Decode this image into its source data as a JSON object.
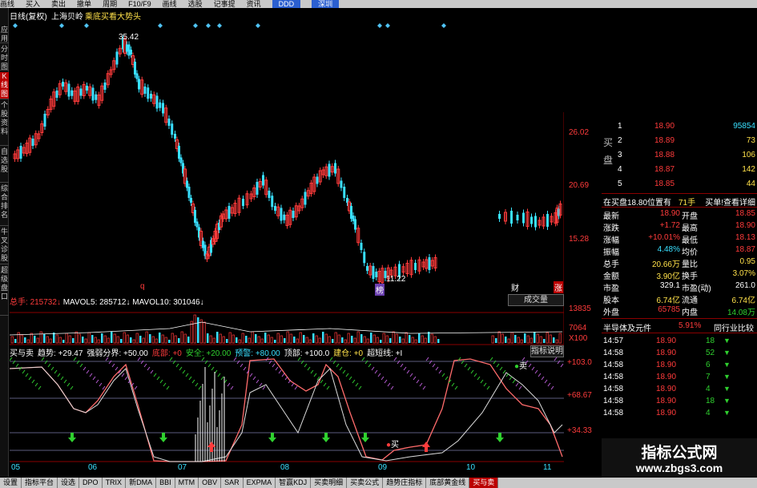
{
  "menubar": {
    "items": [
      "画线",
      "买入",
      "卖出",
      "撤单",
      "周期",
      "F10/F9",
      "画线",
      "选股",
      "记事提",
      "资讯"
    ],
    "badges": [
      "DDD",
      "深圳"
    ]
  },
  "left_tabs": [
    "应用",
    "分时图",
    "K线图",
    "个股资料",
    "自选股",
    "综合排名",
    "牛叉诊股",
    "超级盘口"
  ],
  "chart_header": {
    "period": "日线(复权)",
    "stock_name": "上海贝岭",
    "tip": "乘底买看大势头"
  },
  "price_labels": {
    "high": "35.42",
    "low": "11.22",
    "axis": [
      "26.02",
      "20.69",
      "15.28"
    ]
  },
  "markers": {
    "q": "q",
    "bang": "榜",
    "cai": "财",
    "zhang": "涨"
  },
  "volume_header": {
    "label": "总手",
    "total": "215732",
    "ma5_label": "MAVOL5",
    "ma5": "285712",
    "ma10_label": "MAVOL10",
    "ma10": "301046",
    "button": "成交量",
    "axis": [
      "13835",
      "7064",
      "X100"
    ]
  },
  "indicator_header": {
    "name": "买与卖",
    "items": [
      {
        "label": "趋势",
        "value": "+29.47"
      },
      {
        "label": "强弱分界",
        "value": "+50.00"
      },
      {
        "label": "底部",
        "value": "+0"
      },
      {
        "label": "安全",
        "value": "+20.00"
      },
      {
        "label": "预警",
        "value": "+80.00"
      },
      {
        "label": "顶部",
        "value": "+100.0"
      },
      {
        "label": "建仓",
        "value": "+0"
      },
      {
        "label": "超短线",
        "value": "+I"
      }
    ],
    "button": "指标说明",
    "axis": [
      "+103.0",
      "+68.67",
      "+34.33"
    ],
    "sell_label": "卖",
    "buy_label": "买"
  },
  "x_axis": [
    "05",
    "06",
    "07",
    "08",
    "09",
    "10",
    "11"
  ],
  "order_book": {
    "sell_side_label": "买盘",
    "rows": [
      {
        "level": "1",
        "price": "18.90",
        "vol": "95854"
      },
      {
        "level": "2",
        "price": "18.89",
        "vol": "73"
      },
      {
        "level": "3",
        "price": "18.88",
        "vol": "106"
      },
      {
        "level": "4",
        "price": "18.87",
        "vol": "142"
      },
      {
        "level": "5",
        "price": "18.85",
        "vol": "44"
      }
    ],
    "summary_left": "在买盘18.80位置有",
    "summary_mid": "71手",
    "summary_right": "买单!查看详细"
  },
  "quote": [
    {
      "l": "最新",
      "lv": "18.90",
      "r": "开盘",
      "rv": "18.85"
    },
    {
      "l": "涨跌",
      "lv": "+1.72",
      "r": "最高",
      "rv": "18.90"
    },
    {
      "l": "涨幅",
      "lv": "+10.01%",
      "r": "最低",
      "rv": "18.13"
    },
    {
      "l": "振幅",
      "lv": "4.48%",
      "r": "均价",
      "rv": "18.87"
    },
    {
      "l": "总手",
      "lv": "20.66万",
      "r": "量比",
      "rv": "0.95"
    },
    {
      "l": "金额",
      "lv": "3.90亿",
      "r": "换手",
      "rv": "3.07%"
    },
    {
      "l": "市盈",
      "lv": "329.1",
      "r": "市盈(动)",
      "rv": "261.0"
    },
    {
      "l": "股本",
      "lv": "6.74亿",
      "r": "流通",
      "rv": "6.74亿"
    },
    {
      "l": "外盘",
      "lv": "65785",
      "r": "内盘",
      "rv": "14.08万"
    }
  ],
  "sector": {
    "name": "半导体及元件",
    "change": "5.91%",
    "compare": "同行业比较"
  },
  "ticks": [
    {
      "time": "14:57",
      "price": "18.90",
      "vol": "18"
    },
    {
      "time": "14:58",
      "price": "18.90",
      "vol": "52"
    },
    {
      "time": "14:58",
      "price": "18.90",
      "vol": "6"
    },
    {
      "time": "14:58",
      "price": "18.90",
      "vol": "7"
    },
    {
      "time": "14:58",
      "price": "18.90",
      "vol": "4"
    },
    {
      "time": "14:58",
      "price": "18.90",
      "vol": "18"
    },
    {
      "time": "14:58",
      "price": "18.90",
      "vol": "4"
    }
  ],
  "watermark": {
    "title": "指标公式网",
    "url": "www.zbgs3.com"
  },
  "bottom_tabs": [
    "设置",
    "指标平台",
    "设选",
    "DPO",
    "TRIX",
    "新DMA",
    "BBI",
    "MTM",
    "OBV",
    "SAR",
    "EXPMA",
    "智赢KDJ",
    "买卖明细",
    "买卖公式",
    "趋势庄指标",
    "底部黄金线",
    "买与卖"
  ],
  "colors": {
    "up": "#ff3b3b",
    "down": "#39e0ff",
    "vol_green": "#2fd02f",
    "accent_red": "#b00000"
  }
}
